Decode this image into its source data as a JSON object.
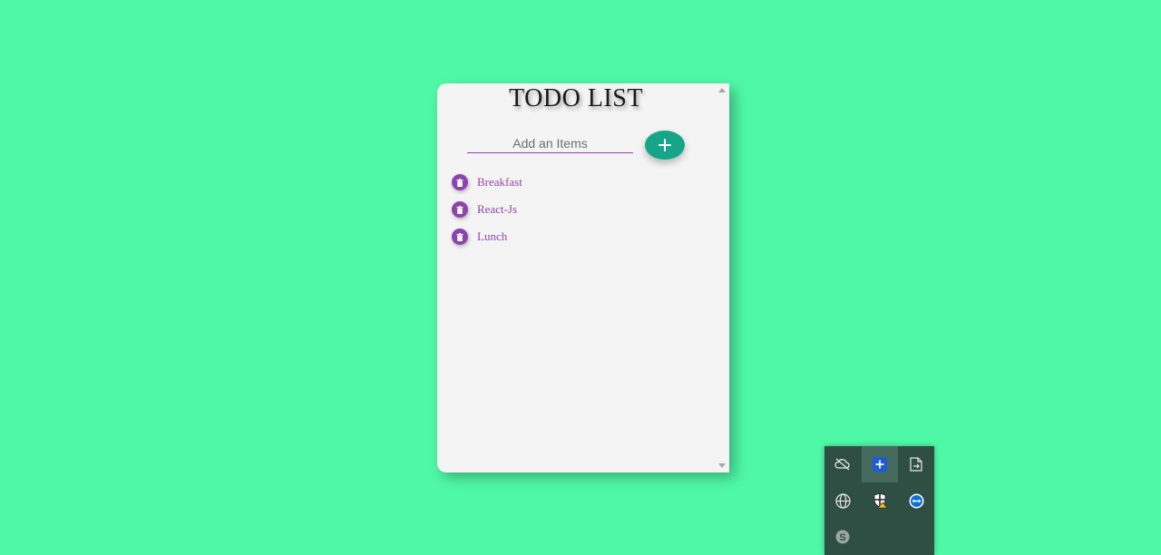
{
  "app": {
    "title": "TODO LIST"
  },
  "input": {
    "placeholder": "Add an Items",
    "value": ""
  },
  "add_button": {
    "icon": "plus-icon",
    "color": "#17a589"
  },
  "todos": [
    {
      "label": "Breakfast"
    },
    {
      "label": "React-Js"
    },
    {
      "label": "Lunch"
    }
  ],
  "colors": {
    "background": "#4ff8a7",
    "card": "#f4f4f4",
    "accent": "#8e44ad",
    "tray": "#2f4f44"
  },
  "tray": {
    "icons": [
      "cloud-offline-icon",
      "add-app-icon",
      "file-export-icon",
      "globe-icon",
      "security-shield-icon",
      "teamviewer-icon",
      "skype-icon"
    ]
  }
}
